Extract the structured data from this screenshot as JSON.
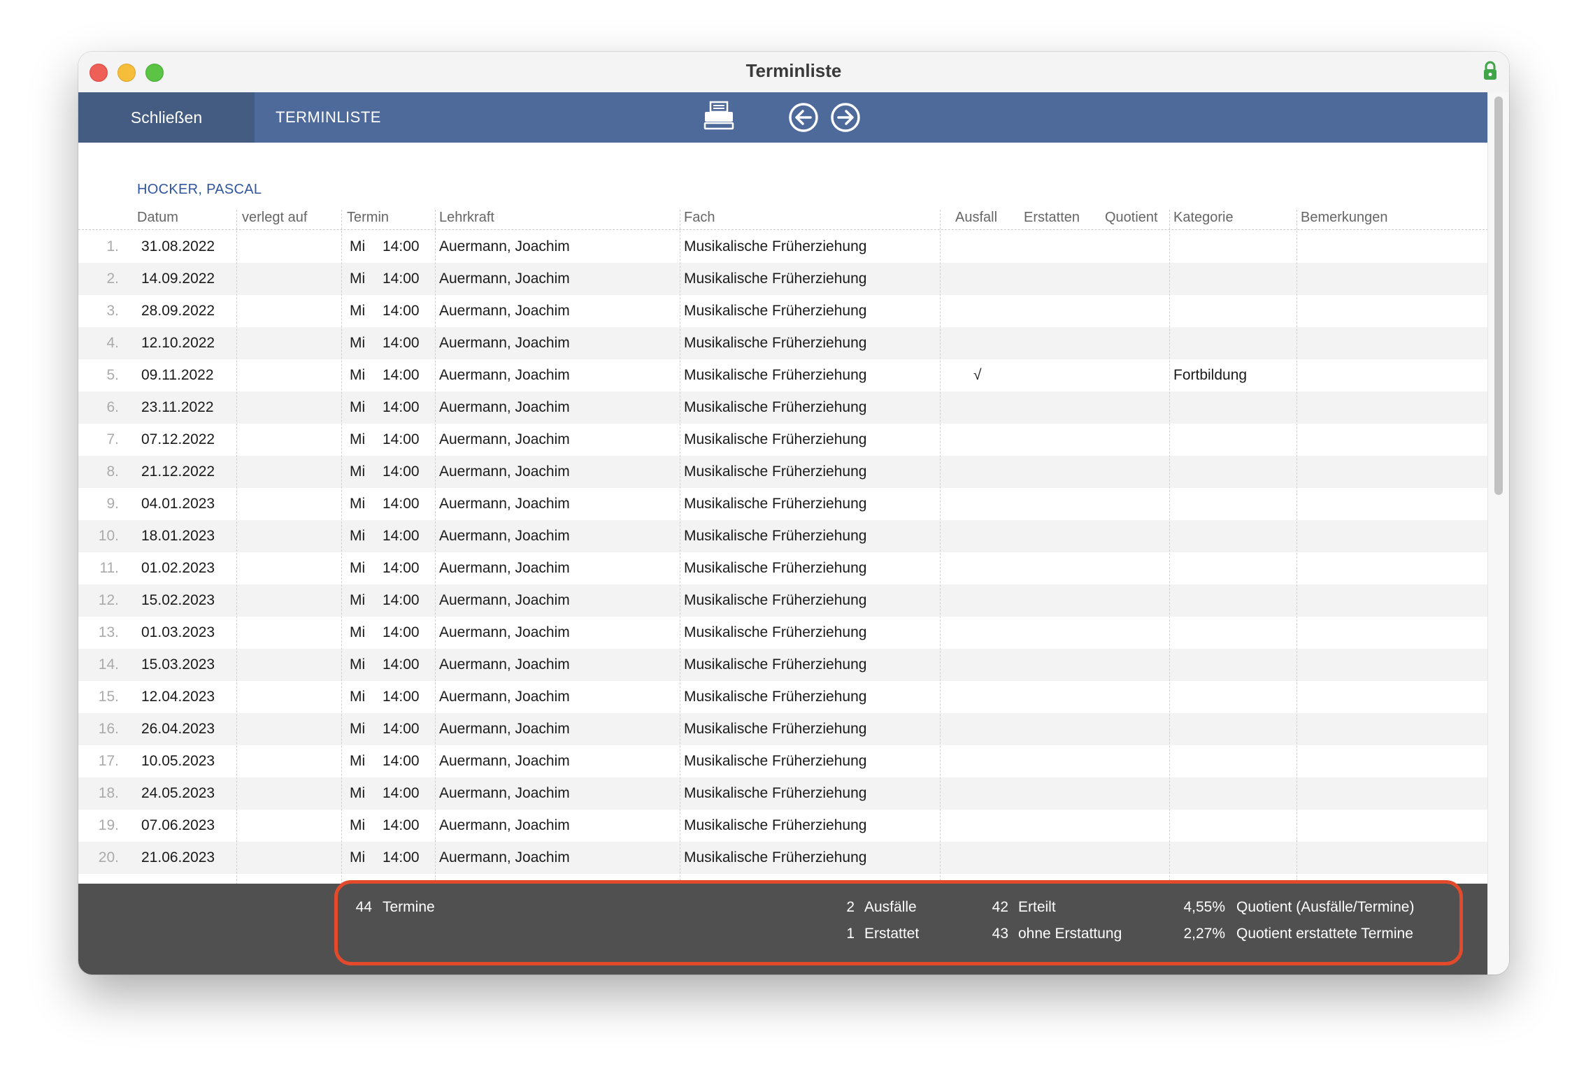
{
  "window": {
    "title": "Terminliste"
  },
  "toolbar": {
    "close_label": "Schließen",
    "title": "TERMINLISTE",
    "print_icon": "printer-icon",
    "back_icon": "arrow-left-circle-icon",
    "forward_icon": "arrow-right-circle-icon"
  },
  "person": {
    "name": "HOCKER, PASCAL"
  },
  "columns": {
    "datum": "Datum",
    "verlegt": "verlegt auf",
    "termin": "Termin",
    "lehrkraft": "Lehrkraft",
    "fach": "Fach",
    "ausfall": "Ausfall",
    "erstatten": "Erstatten",
    "quotient": "Quotient",
    "kategorie": "Kategorie",
    "bemerkungen": "Bemerkungen"
  },
  "rows": [
    {
      "no": "1.",
      "date": "31.08.2022",
      "day": "Mi",
      "time": "14:00",
      "teacher": "Auermann, Joachim",
      "subject": "Musikalische Früherziehung",
      "ausfall": "",
      "kategorie": ""
    },
    {
      "no": "2.",
      "date": "14.09.2022",
      "day": "Mi",
      "time": "14:00",
      "teacher": "Auermann, Joachim",
      "subject": "Musikalische Früherziehung",
      "ausfall": "",
      "kategorie": ""
    },
    {
      "no": "3.",
      "date": "28.09.2022",
      "day": "Mi",
      "time": "14:00",
      "teacher": "Auermann, Joachim",
      "subject": "Musikalische Früherziehung",
      "ausfall": "",
      "kategorie": ""
    },
    {
      "no": "4.",
      "date": "12.10.2022",
      "day": "Mi",
      "time": "14:00",
      "teacher": "Auermann, Joachim",
      "subject": "Musikalische Früherziehung",
      "ausfall": "",
      "kategorie": ""
    },
    {
      "no": "5.",
      "date": "09.11.2022",
      "day": "Mi",
      "time": "14:00",
      "teacher": "Auermann, Joachim",
      "subject": "Musikalische Früherziehung",
      "ausfall": "√",
      "kategorie": "Fortbildung"
    },
    {
      "no": "6.",
      "date": "23.11.2022",
      "day": "Mi",
      "time": "14:00",
      "teacher": "Auermann, Joachim",
      "subject": "Musikalische Früherziehung",
      "ausfall": "",
      "kategorie": ""
    },
    {
      "no": "7.",
      "date": "07.12.2022",
      "day": "Mi",
      "time": "14:00",
      "teacher": "Auermann, Joachim",
      "subject": "Musikalische Früherziehung",
      "ausfall": "",
      "kategorie": ""
    },
    {
      "no": "8.",
      "date": "21.12.2022",
      "day": "Mi",
      "time": "14:00",
      "teacher": "Auermann, Joachim",
      "subject": "Musikalische Früherziehung",
      "ausfall": "",
      "kategorie": ""
    },
    {
      "no": "9.",
      "date": "04.01.2023",
      "day": "Mi",
      "time": "14:00",
      "teacher": "Auermann, Joachim",
      "subject": "Musikalische Früherziehung",
      "ausfall": "",
      "kategorie": ""
    },
    {
      "no": "10.",
      "date": "18.01.2023",
      "day": "Mi",
      "time": "14:00",
      "teacher": "Auermann, Joachim",
      "subject": "Musikalische Früherziehung",
      "ausfall": "",
      "kategorie": ""
    },
    {
      "no": "11.",
      "date": "01.02.2023",
      "day": "Mi",
      "time": "14:00",
      "teacher": "Auermann, Joachim",
      "subject": "Musikalische Früherziehung",
      "ausfall": "",
      "kategorie": ""
    },
    {
      "no": "12.",
      "date": "15.02.2023",
      "day": "Mi",
      "time": "14:00",
      "teacher": "Auermann, Joachim",
      "subject": "Musikalische Früherziehung",
      "ausfall": "",
      "kategorie": ""
    },
    {
      "no": "13.",
      "date": "01.03.2023",
      "day": "Mi",
      "time": "14:00",
      "teacher": "Auermann, Joachim",
      "subject": "Musikalische Früherziehung",
      "ausfall": "",
      "kategorie": ""
    },
    {
      "no": "14.",
      "date": "15.03.2023",
      "day": "Mi",
      "time": "14:00",
      "teacher": "Auermann, Joachim",
      "subject": "Musikalische Früherziehung",
      "ausfall": "",
      "kategorie": ""
    },
    {
      "no": "15.",
      "date": "12.04.2023",
      "day": "Mi",
      "time": "14:00",
      "teacher": "Auermann, Joachim",
      "subject": "Musikalische Früherziehung",
      "ausfall": "",
      "kategorie": ""
    },
    {
      "no": "16.",
      "date": "26.04.2023",
      "day": "Mi",
      "time": "14:00",
      "teacher": "Auermann, Joachim",
      "subject": "Musikalische Früherziehung",
      "ausfall": "",
      "kategorie": ""
    },
    {
      "no": "17.",
      "date": "10.05.2023",
      "day": "Mi",
      "time": "14:00",
      "teacher": "Auermann, Joachim",
      "subject": "Musikalische Früherziehung",
      "ausfall": "",
      "kategorie": ""
    },
    {
      "no": "18.",
      "date": "24.05.2023",
      "day": "Mi",
      "time": "14:00",
      "teacher": "Auermann, Joachim",
      "subject": "Musikalische Früherziehung",
      "ausfall": "",
      "kategorie": ""
    },
    {
      "no": "19.",
      "date": "07.06.2023",
      "day": "Mi",
      "time": "14:00",
      "teacher": "Auermann, Joachim",
      "subject": "Musikalische Früherziehung",
      "ausfall": "",
      "kategorie": ""
    },
    {
      "no": "20.",
      "date": "21.06.2023",
      "day": "Mi",
      "time": "14:00",
      "teacher": "Auermann, Joachim",
      "subject": "Musikalische Früherziehung",
      "ausfall": "",
      "kategorie": ""
    }
  ],
  "summary": {
    "termine_count": "44",
    "termine_label": "Termine",
    "ausfaelle_count": "2",
    "ausfaelle_label": "Ausfälle",
    "erstattet_count": "1",
    "erstattet_label": "Erstattet",
    "erteilt_count": "42",
    "erteilt_label": "Erteilt",
    "ohne_count": "43",
    "ohne_label": "ohne Erstattung",
    "quotient_value": "4,55%",
    "quotient_label": "Quotient (Ausfälle/Termine)",
    "quotient_erstattet_value": "2,27%",
    "quotient_erstattet_label": "Quotient erstattete Termine"
  }
}
